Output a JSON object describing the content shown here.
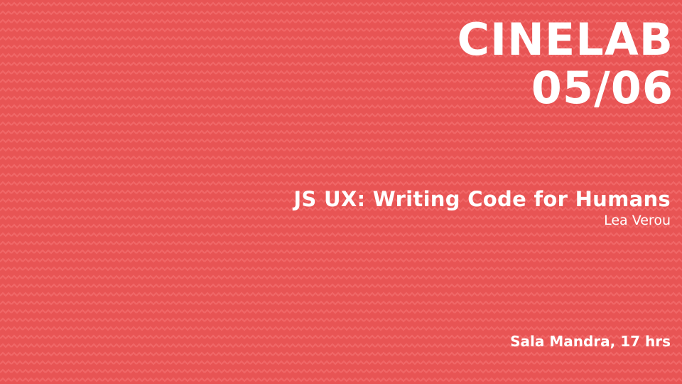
{
  "event": {
    "name": "CINELAB",
    "date": "05/06"
  },
  "talk": {
    "title": "JS UX: Writing Code for Humans",
    "speaker": "Lea Verou"
  },
  "venue": {
    "text": "Sala Mandra, 17 hrs"
  },
  "colors": {
    "background": "#e85454",
    "pattern": "#f06464",
    "text": "#ffffff"
  }
}
